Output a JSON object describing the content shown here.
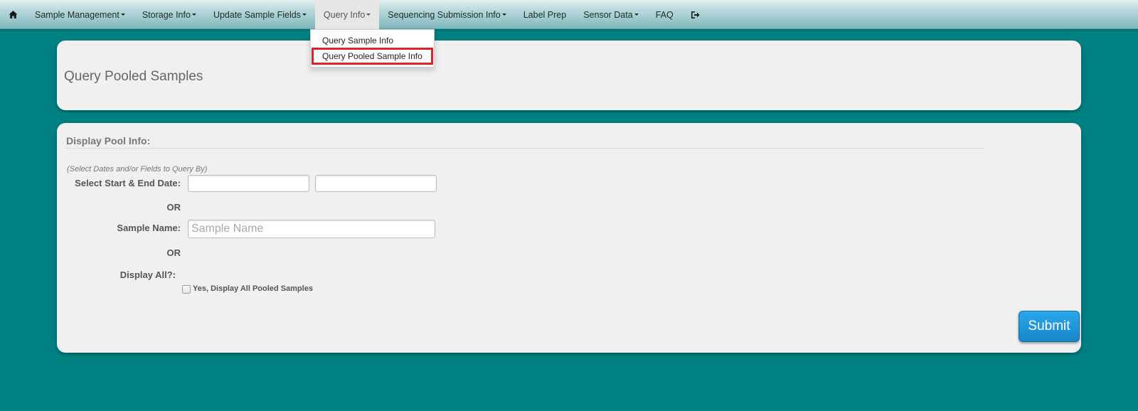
{
  "navbar": {
    "home_icon": "home-icon",
    "items": [
      {
        "label": "Sample Management",
        "has_caret": true
      },
      {
        "label": "Storage Info",
        "has_caret": true
      },
      {
        "label": "Update Sample Fields",
        "has_caret": true
      },
      {
        "label": "Query Info",
        "has_caret": true,
        "active": true
      },
      {
        "label": "Sequencing Submission Info",
        "has_caret": true
      },
      {
        "label": "Label Prep",
        "has_caret": false
      },
      {
        "label": "Sensor Data",
        "has_caret": true
      },
      {
        "label": "FAQ",
        "has_caret": false
      }
    ],
    "logout_icon": "logout-icon"
  },
  "dropdown": {
    "items": [
      {
        "label": "Query Sample Info"
      },
      {
        "label": "Query Pooled Sample Info",
        "highlighted": true
      }
    ]
  },
  "header_panel": {
    "title": "Query Pooled Samples"
  },
  "form": {
    "section_title": "Display Pool Info:",
    "hint": "(Select Dates and/or Fields to Query By)",
    "date_label": "Select Start & End Date:",
    "start_date_value": "",
    "end_date_value": "",
    "or_1": "OR",
    "sample_name_label": "Sample Name:",
    "sample_name_value": "",
    "sample_name_placeholder": "Sample Name",
    "or_2": "OR",
    "display_all_label": "Display All?:",
    "display_all_checked": false,
    "display_all_checkbox_label": "Yes, Display All Pooled Samples",
    "submit_label": "Submit"
  },
  "colors": {
    "background": "#008080",
    "panel": "#f0f0f0",
    "highlight_box": "#e0202a",
    "submit_button": "#1e97d8"
  }
}
